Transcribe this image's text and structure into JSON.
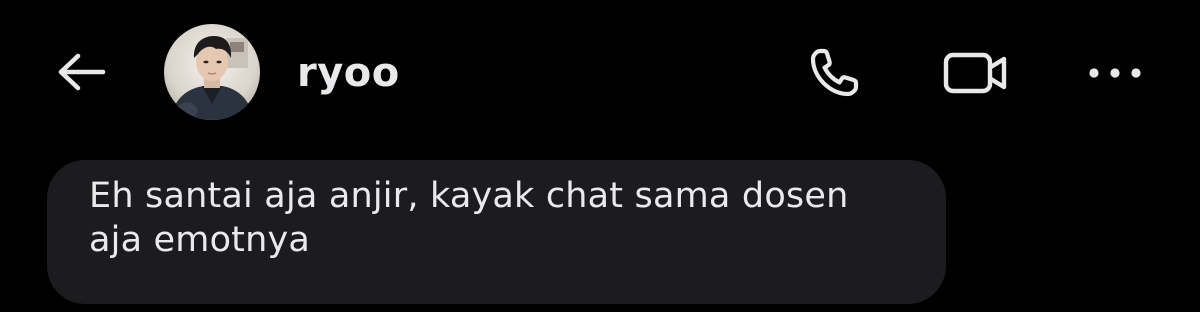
{
  "header": {
    "contact_name": "ryoo",
    "icons": {
      "back": "back-arrow-icon",
      "avatar": "profile-photo",
      "call": "phone-icon",
      "video": "video-camera-icon",
      "more": "more-options-icon"
    }
  },
  "messages": [
    {
      "text": "Eh santai aja anjir, kayak chat sama dosen aja emotnya",
      "direction": "incoming"
    }
  ],
  "colors": {
    "background": "#000000",
    "icon": "#e9e9eb",
    "bubble": "#1c1c1e",
    "text": "#eaeaec"
  }
}
